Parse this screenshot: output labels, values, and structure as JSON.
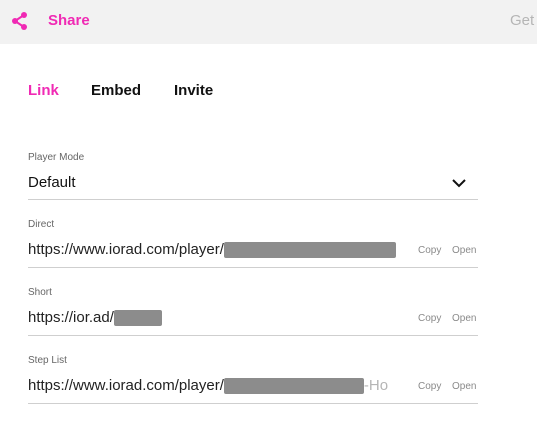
{
  "header": {
    "title": "Share",
    "right_text": "Get"
  },
  "tabs": [
    {
      "label": "Link",
      "active": true
    },
    {
      "label": "Embed",
      "active": false
    },
    {
      "label": "Invite",
      "active": false
    }
  ],
  "player_mode": {
    "label": "Player Mode",
    "value": "Default"
  },
  "direct": {
    "label": "Direct",
    "value_prefix": "https://www.iorad.com/player/",
    "copy_label": "Copy",
    "open_label": "Open"
  },
  "short": {
    "label": "Short",
    "value_prefix": "https://ior.ad/",
    "copy_label": "Copy",
    "open_label": "Open"
  },
  "step_list": {
    "label": "Step List",
    "value_prefix": "https://www.iorad.com/player/",
    "value_suffix": "-Ho",
    "copy_label": "Copy",
    "open_label": "Open"
  },
  "colors": {
    "accent": "#f02ab4",
    "topbar_bg": "#f2f2f2",
    "redaction": "#8c8c8c"
  },
  "icons": {
    "share": "share-icon",
    "dropdown": "chevron-down-icon"
  }
}
